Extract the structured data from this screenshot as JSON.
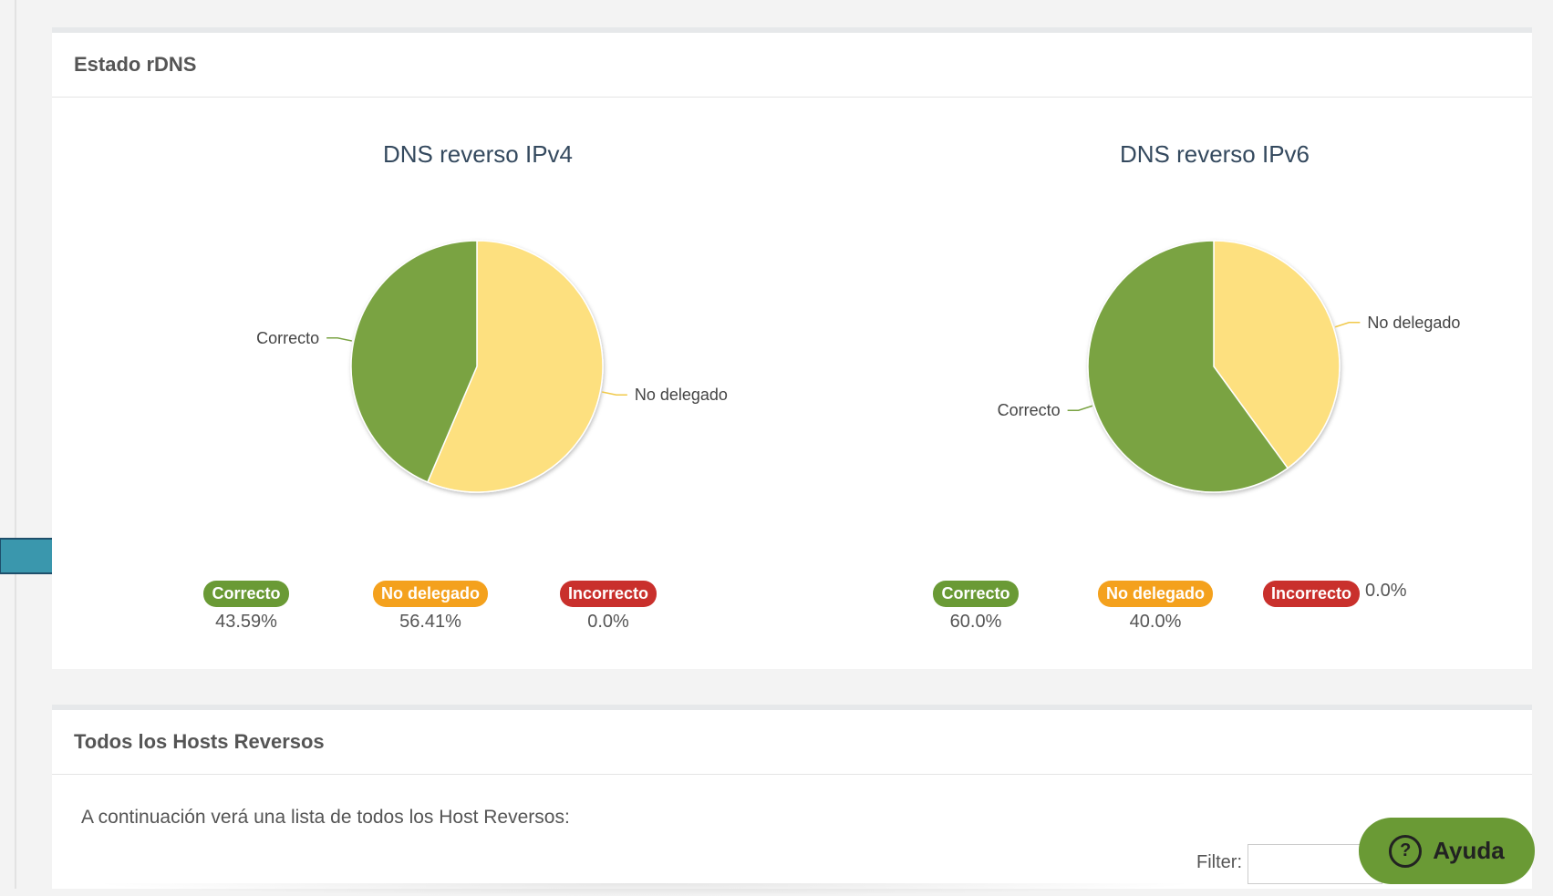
{
  "panel_rdns": {
    "title": "Estado rDNS"
  },
  "charts": {
    "ipv4": {
      "title": "DNS reverso IPv4",
      "pie_labels": {
        "correcto": "Correcto",
        "no_delegado": "No delegado"
      },
      "legend": [
        {
          "label": "Correcto",
          "value": "43.59%"
        },
        {
          "label": "No delegado",
          "value": "56.41%"
        },
        {
          "label": "Incorrecto",
          "value": "0.0%"
        }
      ]
    },
    "ipv6": {
      "title": "DNS reverso IPv6",
      "pie_labels": {
        "correcto": "Correcto",
        "no_delegado": "No delegado"
      },
      "legend": [
        {
          "label": "Correcto",
          "value": "60.0%"
        },
        {
          "label": "No delegado",
          "value": "40.0%"
        },
        {
          "label": "Incorrecto",
          "value": "0.0%"
        }
      ]
    }
  },
  "chart_data": [
    {
      "type": "pie",
      "title": "DNS reverso IPv4",
      "categories": [
        "No delegado",
        "Correcto"
      ],
      "values": [
        56.41,
        43.59
      ],
      "colors": [
        "#fde07f",
        "#7aa343"
      ]
    },
    {
      "type": "pie",
      "title": "DNS reverso IPv6",
      "categories": [
        "No delegado",
        "Correcto"
      ],
      "values": [
        40.0,
        60.0
      ],
      "colors": [
        "#fde07f",
        "#7aa343"
      ]
    }
  ],
  "colors": {
    "correcto": "#6a9a35",
    "no_delegado": "#f4a11d",
    "incorrecto": "#c9302c",
    "pie_green": "#7aa343",
    "pie_yellow": "#fde07f",
    "arrow": "#3a97ad"
  },
  "panel_hosts": {
    "title": "Todos los Hosts Reversos",
    "description": "A continuación verá una lista de todos los Host Reversos:",
    "filter_label": "Filter:",
    "filter_value": ""
  },
  "help_button": {
    "label": "Ayuda",
    "icon": "question-circle-icon"
  }
}
